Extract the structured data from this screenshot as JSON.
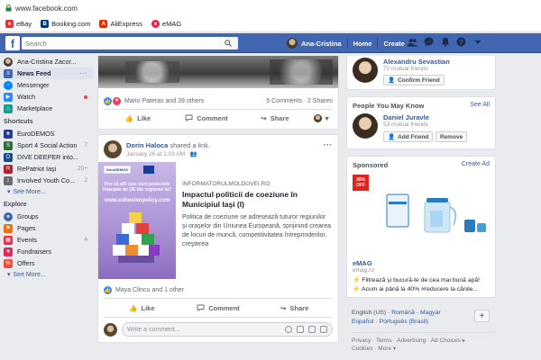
{
  "browser": {
    "url": "www.facebook.com",
    "bookmarks": [
      {
        "label": "eBay",
        "icon": "ebay-icon",
        "color": "#e53238"
      },
      {
        "label": "Booking.com",
        "icon": "booking-icon",
        "color": "#003580"
      },
      {
        "label": "AliExpress",
        "icon": "aliexpress-icon",
        "color": "#e62e04"
      },
      {
        "label": "eMAG",
        "icon": "emag-icon",
        "color": "#e6214f"
      }
    ]
  },
  "topbar": {
    "brand_letter": "f",
    "search_placeholder": "Search",
    "user": "Ana-Cristina",
    "home": "Home",
    "create": "Create",
    "brand_color": "#4267b2"
  },
  "sidebar": {
    "user": "Ana-Cristina Zacor...",
    "main": [
      {
        "label": "News Feed",
        "icon": "news-feed-icon",
        "color": "#4267b2",
        "active": true
      },
      {
        "label": "Messenger",
        "icon": "messenger-icon",
        "color": "#0084ff"
      },
      {
        "label": "Watch",
        "icon": "watch-icon",
        "color": "#2d88ff"
      },
      {
        "label": "Marketplace",
        "icon": "marketplace-icon",
        "color": "#1a9e8f"
      }
    ],
    "shortcuts_title": "Shortcuts",
    "shortcuts": [
      {
        "label": "EuroDEMOS",
        "icon": "eurodemos-icon",
        "color": "#253e8c",
        "count": ""
      },
      {
        "label": "Sport 4 Social Action",
        "icon": "sport-icon",
        "color": "#2a6f3a",
        "count": "7"
      },
      {
        "label": "DIVE DEEPER into...",
        "icon": "dive-deeper-icon",
        "color": "#1a4a8a",
        "count": ""
      },
      {
        "label": "RePatriot Iaşi",
        "icon": "repatriot-icon",
        "color": "#b11f2a",
        "count": "20+"
      },
      {
        "label": "Involved Youth Co...",
        "icon": "involved-youth-icon",
        "color": "#6b6b6b",
        "count": "2"
      }
    ],
    "see_more": "See More...",
    "explore_title": "Explore",
    "explore": [
      {
        "label": "Groups",
        "icon": "groups-icon",
        "color": "#4267b2",
        "count": ""
      },
      {
        "label": "Pages",
        "icon": "pages-icon",
        "color": "#e9710f",
        "count": ""
      },
      {
        "label": "Events",
        "icon": "events-icon",
        "color": "#f02849",
        "count": "4"
      },
      {
        "label": "Fundraisers",
        "icon": "fundraisers-icon",
        "color": "#e42c5c",
        "count": ""
      },
      {
        "label": "Offers",
        "icon": "offers-icon",
        "color": "#e8513a",
        "count": ""
      }
    ],
    "see_more_2": "See More..."
  },
  "post1": {
    "reactions": "Mario Pateras and 39 others",
    "comments": "5 Comments",
    "shares": "2 Shares",
    "like": "Like",
    "comment": "Comment",
    "share": "Share"
  },
  "post2": {
    "author": "Dorin Haloca",
    "shared": "shared a link.",
    "time": "January 26 at 1:03 AM · ",
    "image": {
      "logo_text": "EuroDEMOS",
      "headline": "Vrei să afli care sunt proiectele finanţate de UE din regiunea ta?",
      "url": "www.cohesionpolicy.com"
    },
    "site": "INFORMATORULMOLDOVEI.RO",
    "title": "Impactul politicii de coeziune în Municipiul Iaşi (I)",
    "description": "Politica de coeziune se adresează tuturor regiunilor şi oraşelor din Uniunea Europeană, sprijinind crearea de locuri de muncă, competitivitatea întreprinderilor, creşterea",
    "reactions": "Maya Clincu and 1 other",
    "like": "Like",
    "comment": "Comment",
    "share": "Share",
    "comment_placeholder": "Write a comment..."
  },
  "right": {
    "suggested": {
      "name": "Alexandru Sevastian",
      "mutual": "72 mutual friends",
      "button": "Confirm Friend"
    },
    "pymk_title": "People You May Know",
    "see_all": "See All",
    "pymk": {
      "name": "Daniel Juravle",
      "mutual": "53 mutual friends",
      "add": "Add Friend",
      "remove": "Remove"
    },
    "sponsored_title": "Sponsored",
    "create_ad": "Create Ad",
    "ad": {
      "badge": "35% OFF",
      "name": "eMAG",
      "url": "emag.ro",
      "copy1": "⚡ Filtrează şi bucură-te de cea mai bună apă!",
      "copy2": "⚡ Acum ai până la 40% #reducere la cănile..."
    },
    "languages": {
      "current": "English (US)",
      "others": [
        "Română",
        "Magyar",
        "Español",
        "Português (Brasil)"
      ]
    },
    "footer": {
      "links": [
        "Privacy",
        "Terms",
        "Advertising",
        "Ad Choices ▸",
        "Cookies",
        "More ▾"
      ]
    }
  }
}
